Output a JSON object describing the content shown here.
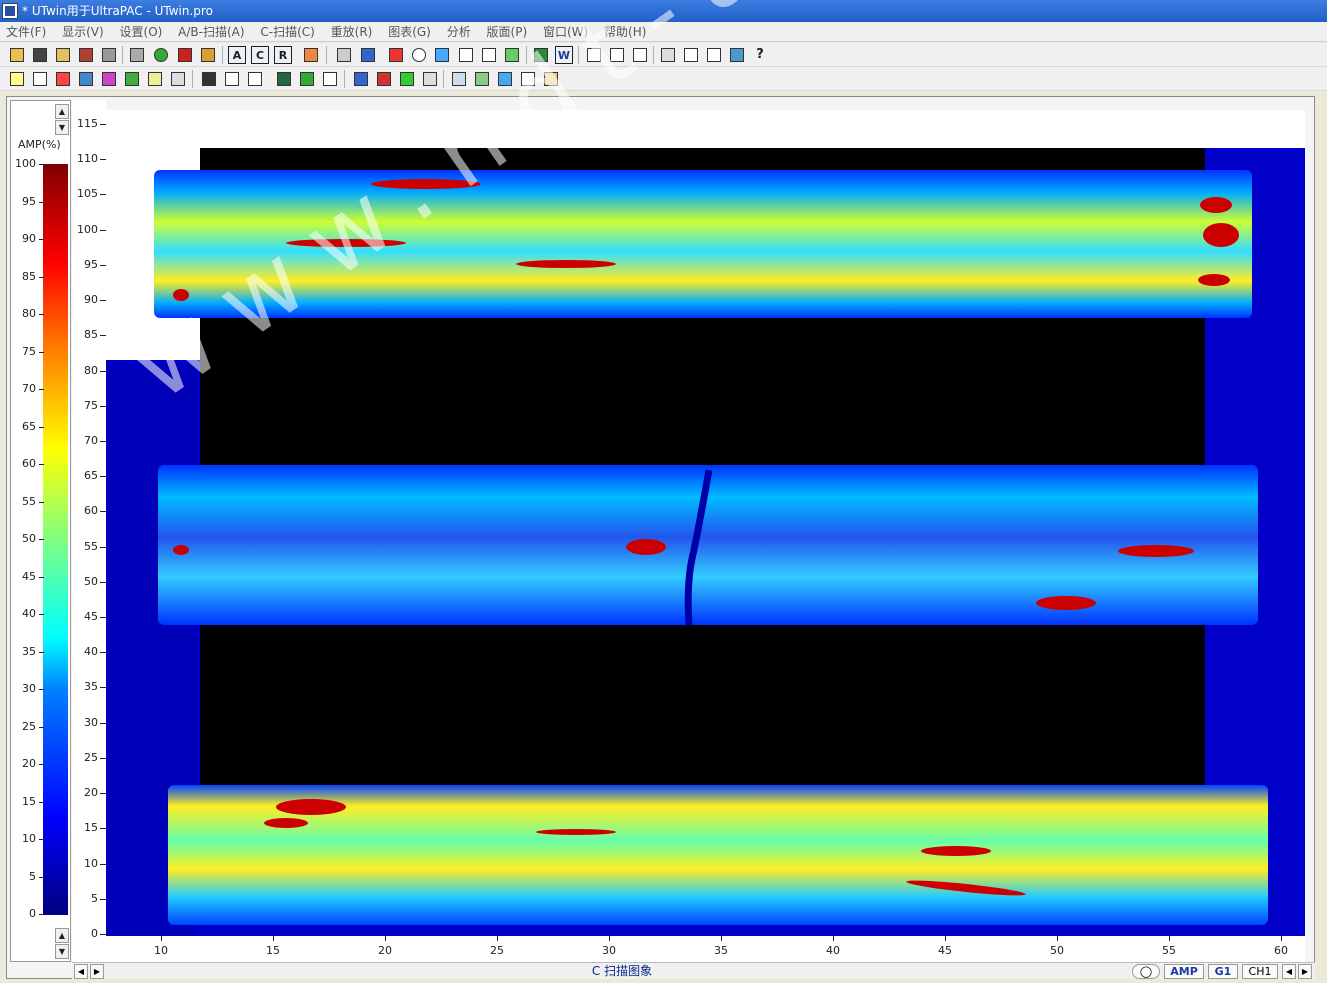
{
  "window": {
    "title": "* UTwin用于UltraPAC - UTwin.pro"
  },
  "menu": [
    "文件(F)",
    "显示(V)",
    "设置(O)",
    "A/B-扫描(A)",
    "C-扫描(C)",
    "重放(R)",
    "图表(G)",
    "分析",
    "版面(P)",
    "窗口(W)",
    "帮助(H)"
  ],
  "toolbar": {
    "text_buttons": [
      "A",
      "C",
      "R",
      "W"
    ]
  },
  "legend": {
    "title": "AMP(%)",
    "ticks": [
      "100",
      "95",
      "90",
      "85",
      "80",
      "75",
      "70",
      "65",
      "60",
      "55",
      "50",
      "45",
      "40",
      "35",
      "30",
      "25",
      "20",
      "15",
      "10",
      "5",
      "0"
    ]
  },
  "y_axis": {
    "ticks": [
      "115",
      "110",
      "105",
      "100",
      "95",
      "90",
      "85",
      "80",
      "75",
      "70",
      "65",
      "60",
      "55",
      "50",
      "45",
      "40",
      "35",
      "30",
      "25",
      "20",
      "15",
      "10",
      "5",
      "0"
    ]
  },
  "x_axis": {
    "ticks": [
      "10",
      "15",
      "20",
      "25",
      "30",
      "35",
      "40",
      "45",
      "50",
      "55",
      "60"
    ]
  },
  "watermark": "www.ndt-auto.com",
  "status": {
    "view_title": "C 扫描图象",
    "tab_amp": "AMP",
    "tab_gate": "G1",
    "tab_channel": "CH1"
  },
  "colors": {
    "titlebar": "#1f5fc8",
    "palette_low": "#00007f",
    "palette_high": "#800000",
    "plot_background": "#0000c8"
  }
}
